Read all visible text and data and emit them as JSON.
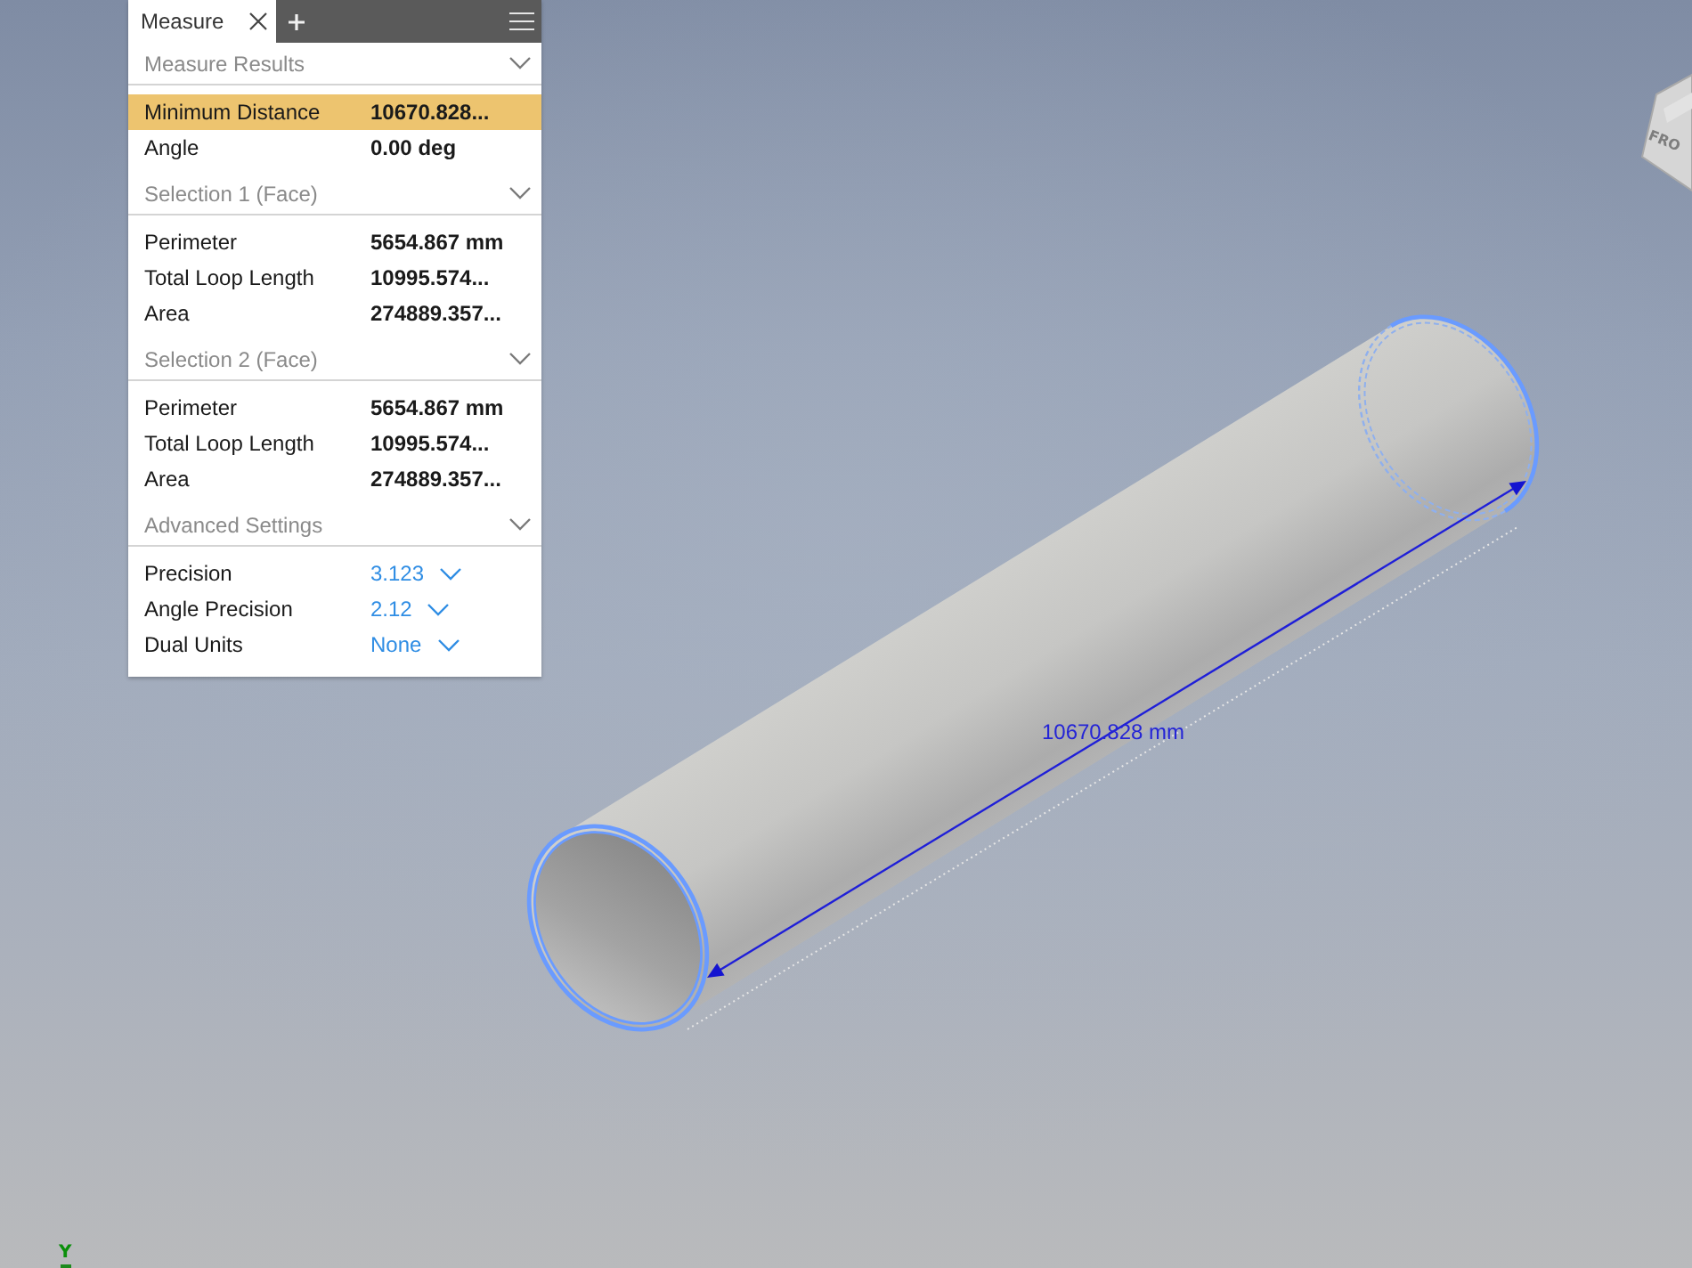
{
  "panel": {
    "tabs": [
      {
        "label": "Measure",
        "selected": true
      }
    ],
    "sections": [
      {
        "title": "Measure Results",
        "expanded": true,
        "rows": [
          {
            "kind": "readout",
            "label": "Minimum Distance",
            "value": "10670.828...",
            "selected": true
          },
          {
            "kind": "readout",
            "label": "Angle",
            "value": "0.00 deg",
            "selected": false
          }
        ]
      },
      {
        "title": "Selection 1 (Face)",
        "expanded": true,
        "rows": [
          {
            "kind": "readout",
            "label": "Perimeter",
            "value": "5654.867 mm",
            "selected": false
          },
          {
            "kind": "readout",
            "label": "Total Loop Length",
            "value": "10995.574...",
            "selected": false
          },
          {
            "kind": "readout",
            "label": "Area",
            "value": "274889.357...",
            "selected": false
          }
        ]
      },
      {
        "title": "Selection 2 (Face)",
        "expanded": true,
        "rows": [
          {
            "kind": "readout",
            "label": "Perimeter",
            "value": "5654.867 mm",
            "selected": false
          },
          {
            "kind": "readout",
            "label": "Total Loop Length",
            "value": "10995.574...",
            "selected": false
          },
          {
            "kind": "readout",
            "label": "Area",
            "value": "274889.357...",
            "selected": false
          }
        ]
      },
      {
        "title": "Advanced Settings",
        "expanded": true,
        "rows": [
          {
            "kind": "dropdown",
            "label": "Precision",
            "value": "3.123"
          },
          {
            "kind": "dropdown",
            "label": "Angle Precision",
            "value": "2.12"
          },
          {
            "kind": "dropdown",
            "label": "Dual Units",
            "value": "None"
          }
        ]
      }
    ]
  },
  "viewport": {
    "dimension_label": "10670.828 mm",
    "view_cube_label": "FRO",
    "axis_label": "Y"
  }
}
